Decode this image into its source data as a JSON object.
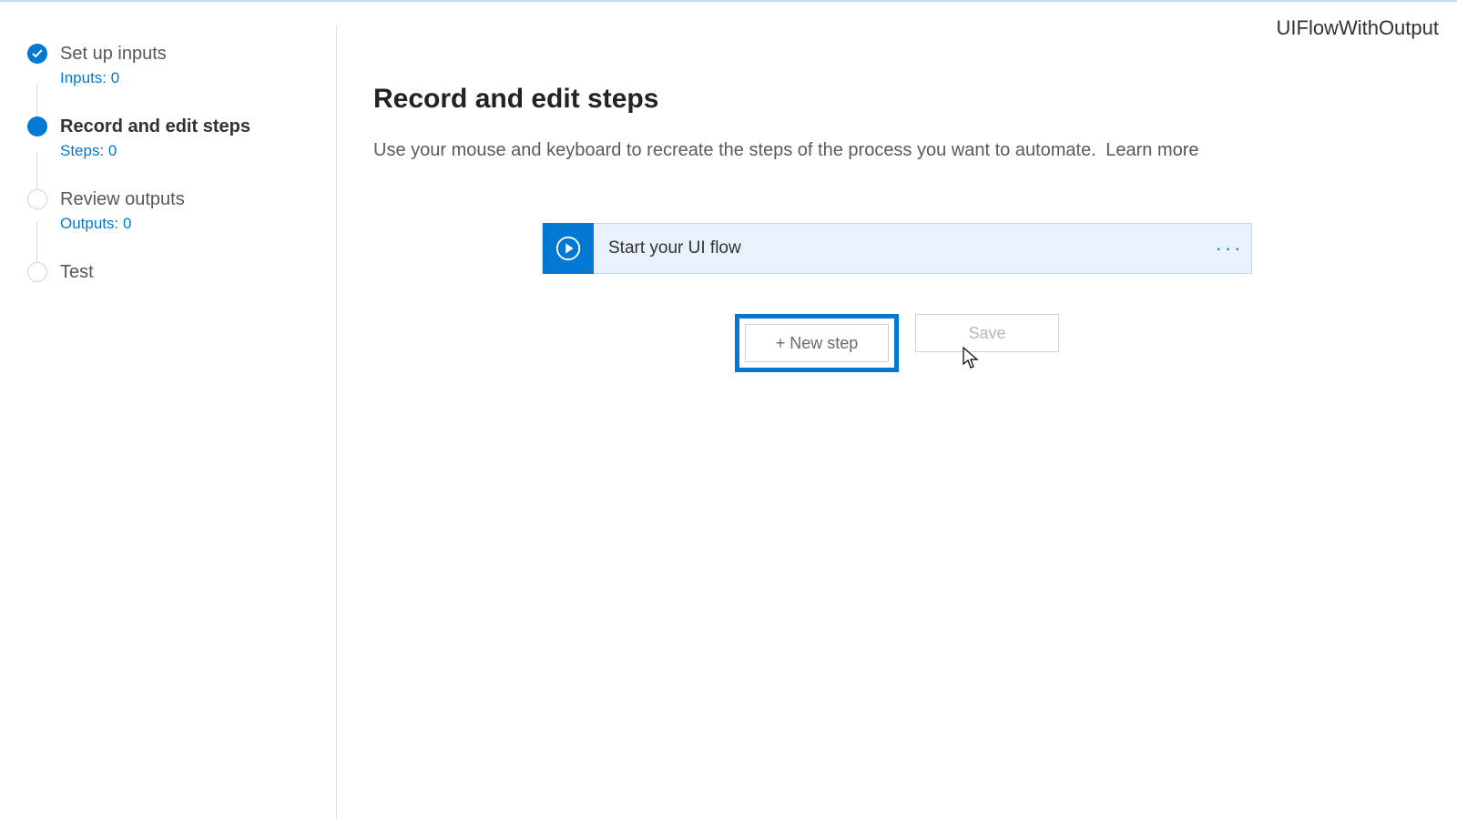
{
  "header": {
    "flow_name": "UIFlowWithOutput"
  },
  "sidebar": {
    "items": [
      {
        "label": "Set up inputs",
        "sub": "Inputs: 0",
        "state": "done"
      },
      {
        "label": "Record and edit steps",
        "sub": "Steps: 0",
        "state": "current"
      },
      {
        "label": "Review outputs",
        "sub": "Outputs: 0",
        "state": "future"
      },
      {
        "label": "Test",
        "sub": "",
        "state": "future"
      }
    ]
  },
  "main": {
    "title": "Record and edit steps",
    "description": "Use your mouse and keyboard to recreate the steps of the process you want to automate.",
    "learn_more": "Learn more",
    "flow_card_label": "Start your UI flow",
    "new_step_label": "+ New step",
    "save_label": "Save"
  }
}
